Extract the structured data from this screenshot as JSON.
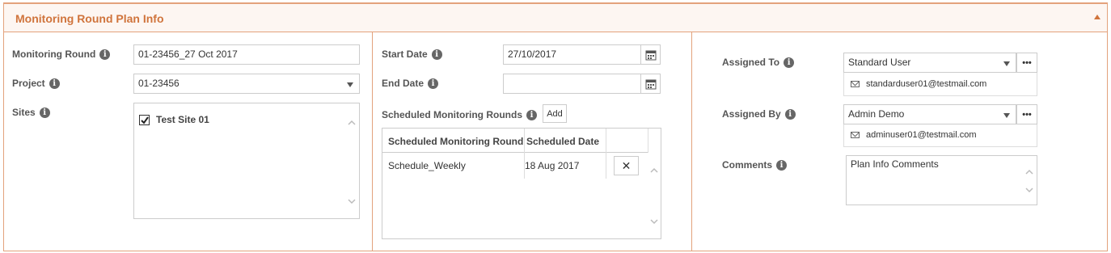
{
  "panel": {
    "title": "Monitoring Round Plan Info"
  },
  "left": {
    "monitoring_round_label": "Monitoring Round",
    "monitoring_round_value": "01-23456_27 Oct 2017",
    "project_label": "Project",
    "project_value": "01-23456",
    "sites_label": "Sites",
    "sites": [
      {
        "name": "Test Site 01",
        "checked": true
      }
    ]
  },
  "middle": {
    "start_date_label": "Start Date",
    "start_date_value": "27/10/2017",
    "end_date_label": "End Date",
    "end_date_value": "",
    "scheduled_label": "Scheduled Monitoring Rounds",
    "add_button": "Add",
    "table": {
      "headers": [
        "Scheduled Monitoring Round",
        "Scheduled Date"
      ],
      "rows": [
        {
          "name": "Schedule_Weekly",
          "date": "18 Aug 2017",
          "remove": "✕"
        }
      ]
    }
  },
  "right": {
    "assigned_to_label": "Assigned To",
    "assigned_to_value": "Standard User",
    "assigned_to_email": "standarduser01@testmail.com",
    "assigned_by_label": "Assigned By",
    "assigned_by_value": "Admin Demo",
    "assigned_by_email": "adminuser01@testmail.com",
    "comments_label": "Comments",
    "comments_value": "Plan Info Comments",
    "more_button": "•••"
  },
  "icons": {
    "info": "info-icon",
    "calendar": "calendar-icon",
    "mail": "mail-icon",
    "caret": "caret-down-icon"
  },
  "colors": {
    "accent": "#d0743c",
    "border": "#e3a27c",
    "header_bg": "#fdf6f2"
  }
}
